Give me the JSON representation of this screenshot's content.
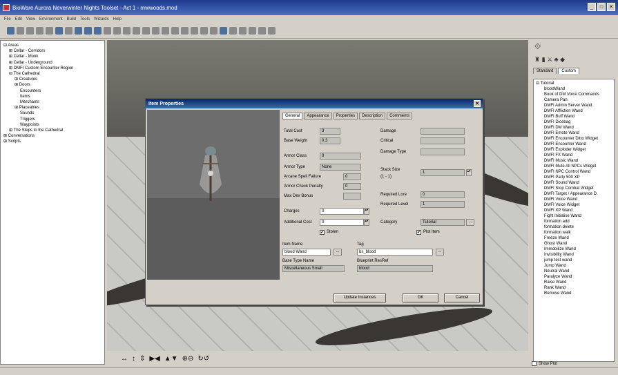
{
  "window": {
    "title": "BioWare Aurora Neverwinter Nights Toolset - Act 1 - mwwoods.mod",
    "controls": [
      "_",
      "□",
      "✕"
    ]
  },
  "menu": [
    "File",
    "Edit",
    "View",
    "Environment",
    "Build",
    "Tools",
    "Wizards",
    "Help"
  ],
  "tree": {
    "items": [
      {
        "text": "⊟ Areas",
        "indent": 0
      },
      {
        "text": "⊞ Cellar - Corridors",
        "indent": 1
      },
      {
        "text": "⊞ Cellar - Monk",
        "indent": 1
      },
      {
        "text": "⊞ Cellar - Underground",
        "indent": 1
      },
      {
        "text": "⊞ DMFI Custom Encounter Region",
        "indent": 1
      },
      {
        "text": "⊟ The Cathedral",
        "indent": 1
      },
      {
        "text": "⊞ Creatures",
        "indent": 2
      },
      {
        "text": "⊞ Doors",
        "indent": 2
      },
      {
        "text": "Encounters",
        "indent": 3
      },
      {
        "text": "Items",
        "indent": 3
      },
      {
        "text": "Merchants",
        "indent": 3
      },
      {
        "text": "⊞ Placeables",
        "indent": 2
      },
      {
        "text": "Sounds",
        "indent": 3
      },
      {
        "text": "Triggers",
        "indent": 3
      },
      {
        "text": "Waypoints",
        "indent": 3
      },
      {
        "text": "⊞ The Steps to the Cathedral",
        "indent": 1
      },
      {
        "text": "⊞ Conversations",
        "indent": 0
      },
      {
        "text": "⊞ Scripts",
        "indent": 0
      }
    ]
  },
  "palette": {
    "tabs": [
      "Standard",
      "Custom"
    ],
    "root": "⊟ Tutorial",
    "items": [
      "bloodWand",
      "Book of DM Voice Commands",
      "Camera Pan",
      "DMFI Admin Server Wand",
      "DMFI Affliction Wand",
      "DMFI Buff Wand",
      "DMFI Dicebag",
      "DMFI DM Wand",
      "DMFI Emote Wand",
      "DMFI Encounter Ditto Widget",
      "DMFI Encounter Wand",
      "DMFI Exploder Widget",
      "DMFI FX Wand",
      "DMFI Music Wand",
      "DMFI Mute All NPCs Widget",
      "DMFI NPC Control Wand",
      "DMFI Party 500 XP",
      "DMFI Sound Wand",
      "DMFI Stop Combat Widget",
      "DMFI Target / Appearance D.",
      "DMFI Voice Wand",
      "DMFI Voice Widget",
      "DMFI XP Wand",
      "Fight Initialise Wand",
      "formation add",
      "formation delete",
      "formation walk",
      "Freeze Wand",
      "Ghost Wand",
      "Immobilize Wand",
      "Invisibility Wand",
      "jump test wand",
      "Jump Wand",
      "Neutral Wand",
      "Paralyze Wand",
      "Raise Wand",
      "Rank Wand",
      "Remove Wand"
    ],
    "show_plot": "Show Plot"
  },
  "dialog": {
    "title": "Item Properties",
    "tabs": [
      "General",
      "Appearance",
      "Properties",
      "Description",
      "Comments"
    ],
    "labels": {
      "total_cost": "Total Cost",
      "base_weight": "Base Weight",
      "armor_class": "Armor Class",
      "armor_type": "Armor Type",
      "arcane_spell_failure": "Arcane Spell Failure",
      "armor_check_penalty": "Armor Check Penalty",
      "max_dex_bonus": "Max Dex Bonus",
      "charges": "Charges",
      "additional_cost": "Additional Cost",
      "stolen": "Stolen",
      "damage": "Damage",
      "critical": "Critical",
      "damage_type": "Damage Type",
      "stack_size": "Stack Size",
      "stack_range": "(1 - 1)",
      "required_lore": "Required Lore",
      "required_level": "Required Level",
      "category": "Category",
      "plot_item": "Plot Item",
      "item_name": "Item Name",
      "tag": "Tag",
      "base_type_name": "Base Type Name",
      "blueprint_resref": "Blueprint ResRef"
    },
    "values": {
      "total_cost": "3",
      "base_weight": "0.3",
      "armor_class": "0",
      "armor_type": "None",
      "arcane_spell_failure": "0",
      "armor_check_penalty": "0",
      "charges": "0",
      "additional_cost": "0",
      "stack_size": "1",
      "required_lore": "0",
      "required_level": "1",
      "category": "Tutorial",
      "item_name": "blood Wand",
      "tag": "bs_blood",
      "base_type_name": "Miscellaneous Small",
      "blueprint_resref": "blood"
    },
    "checks": {
      "stolen": "✔",
      "plot_item": "✔"
    },
    "buttons": {
      "update": "Update Instances",
      "ok": "OK",
      "cancel": "Cancel",
      "dots": "..."
    }
  }
}
